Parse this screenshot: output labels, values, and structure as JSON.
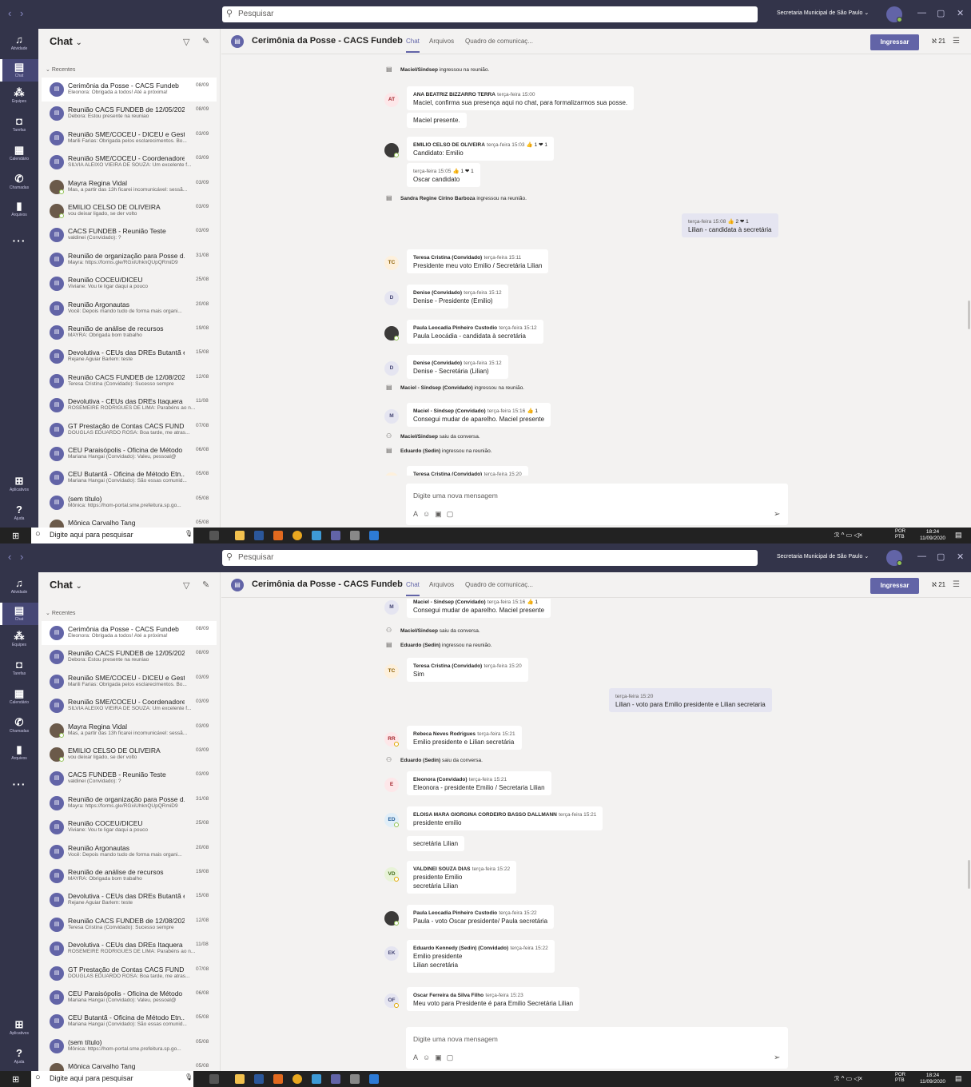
{
  "app": {
    "search_placeholder": "Pesquisar",
    "org": "Secretaria Municipal de São Paulo",
    "rail": [
      "Atividade",
      "Chat",
      "Equipes",
      "Tarefas",
      "Calendário",
      "Chamadas",
      "Arquivos"
    ],
    "rail_bottom": [
      "Aplicativos",
      "Ajuda"
    ]
  },
  "chatlist": {
    "title": "Chat",
    "section": "Recentes",
    "items": [
      {
        "title": "Cerimônia da Posse - CACS Fundeb",
        "preview": "Eleonora: Obrigada a todos! Até a próxima!",
        "date": "08/09"
      },
      {
        "title": "Reunião CACS FUNDEB de 12/05/2020",
        "preview": "Debora: Estou presente na reuniao",
        "date": "08/09"
      },
      {
        "title": "Reunião SME/COCEU - DICEU e Gesto...",
        "preview": "Marili Farias: Obrigada pelos esclarecimentos. Bo...",
        "date": "03/09"
      },
      {
        "title": "Reunião SME/COCEU - Coordenadore...",
        "preview": "SILVIA ALEIXO VIEIRA DE SOUZA: Um excelente f...",
        "date": "03/09"
      },
      {
        "title": "Mayra Regina Vidal",
        "preview": "Mas, a partir das 13h ficarei incomunicável: sessã...",
        "date": "03/09"
      },
      {
        "title": "EMILIO CELSO DE OLIVEIRA",
        "preview": "vou deixar ligado, se der volto",
        "date": "03/09"
      },
      {
        "title": "CACS FUNDEB - Reunião Teste",
        "preview": "valdinei (Convidado): ?",
        "date": "03/09"
      },
      {
        "title": "Reunião de organização para Posse d...",
        "preview": "Mayra: https://forms.gle/RGxiUhknQUpQRmiD9",
        "date": "31/08"
      },
      {
        "title": "Reunião COCEU/DICEU",
        "preview": "Viviane: Vou te ligar daqui a pouco",
        "date": "25/08"
      },
      {
        "title": "Reunião Argonautas",
        "preview": "Você: Depois mando tudo de forma mais organi...",
        "date": "20/08"
      },
      {
        "title": "Reunião de análise de recursos",
        "preview": "MAYRA: Obrigada bom trabalho",
        "date": "19/08"
      },
      {
        "title": "Devolutiva - CEUs das DREs Butantã e ...",
        "preview": "Rejane Aguiar Barlem: teste",
        "date": "15/08"
      },
      {
        "title": "Reunião CACS FUNDEB de 12/08/2020",
        "preview": "Teresa Cristina (Convidado): Sucesso sempre",
        "date": "12/08"
      },
      {
        "title": "Devolutiva - CEUs das DREs Itaquera e...",
        "preview": "ROSEMEIRE RODRIGUES DE LIMA: Parabéns ao n...",
        "date": "11/08"
      },
      {
        "title": "GT Prestação de Contas CACS FUNDE...",
        "preview": "DOUGLAS EDUARDO ROSA: Boa tarde, me atras...",
        "date": "07/08"
      },
      {
        "title": "CEU Paraisópolis - Oficina de Método ...",
        "preview": "Mariana Hangai (Convidado): Valeu, pessoal@",
        "date": "06/08"
      },
      {
        "title": "CEU Butantã - Oficina de Método Etn...",
        "preview": "Mariana Hangai (Convidado): São essas comunid...",
        "date": "05/08"
      },
      {
        "title": "(sem título)",
        "preview": "Mônica: https://hom-portal.sme.prefeitura.sp.go...",
        "date": "05/08"
      },
      {
        "title": "Mônica Carvalho Tang",
        "preview": "",
        "date": "05/08"
      }
    ]
  },
  "header": {
    "title": "Cerimônia da Posse - CACS Fundeb",
    "tabs": [
      "Chat",
      "Arquivos",
      "Quadro de comunicaç..."
    ],
    "join": "Ingressar",
    "participants": "21"
  },
  "compose_placeholder": "Digite uma nova mensagem",
  "screen1": [
    {
      "kind": "sys",
      "icon": "join",
      "name": "Maciel/Sindsep",
      "text": "ingressou na reunião."
    },
    {
      "kind": "msg",
      "initials": "AT",
      "name": "ANA BEATRIZ BIZZARRO TERRA",
      "time": "terça-feira 15:00",
      "reactions": "",
      "lines": [
        "Maciel, confirma sua presença aqui no chat, para formalizarmos sua posse."
      ]
    },
    {
      "kind": "cont",
      "lines": [
        "Maciel presente."
      ]
    },
    {
      "kind": "msg",
      "initials": "",
      "name": "EMILIO CELSO DE OLIVEIRA",
      "time": "terça-feira 15:03",
      "reactions": "👍 1  ❤ 1",
      "lines": [
        "Candidato: Emilio"
      ]
    },
    {
      "kind": "cont",
      "name": "",
      "time": "terça-feira 15:05",
      "reactions": "👍 1  ❤ 1",
      "lines": [
        "Oscar candidato"
      ]
    },
    {
      "kind": "sys",
      "icon": "join",
      "name": "Sandra Regine Cirino Barboza",
      "text": "ingressou na reunião."
    },
    {
      "kind": "self",
      "time": "terça-feira 15:08",
      "reactions": "👍 2  ❤ 1",
      "lines": [
        "Lilian - candidata à secretária"
      ]
    },
    {
      "kind": "msg",
      "initials": "TC",
      "name": "Teresa Cristina (Convidado)",
      "time": "terça-feira 15:11",
      "reactions": "",
      "lines": [
        "Presidente meu voto  Emilio / Secretária Lilian"
      ]
    },
    {
      "kind": "msg",
      "initials": "D",
      "name": "Denise (Convidado)",
      "time": "terça-feira 15:12",
      "reactions": "",
      "lines": [
        "Denise - Presidente (Emilio)"
      ]
    },
    {
      "kind": "msg",
      "initials": "",
      "name": "Paula Leocadia Pinheiro Custodio",
      "time": "terça-feira 15:12",
      "reactions": "",
      "lines": [
        "Paula Leocádia - candidata à secretária"
      ]
    },
    {
      "kind": "msg",
      "initials": "D",
      "name": "Denise (Convidado)",
      "time": "terça-feira 15:12",
      "reactions": "",
      "lines": [
        "Denise - Secretária  (Lilian)"
      ]
    },
    {
      "kind": "sys",
      "icon": "join",
      "name": "Maciel - Sindsep (Convidado)",
      "text": "ingressou na reunião."
    },
    {
      "kind": "msg",
      "initials": "M",
      "name": "Maciel - Sindsep (Convidado)",
      "time": "terça-feira 15:16",
      "reactions": "👍 1",
      "lines": [
        "Consegui mudar de aparelho. Maciel presente"
      ]
    },
    {
      "kind": "sys",
      "icon": "leave",
      "name": "Maciel/Sindsep",
      "text": "saiu da conversa."
    },
    {
      "kind": "sys",
      "icon": "join",
      "name": "Eduardo (Sedin)",
      "text": "ingressou na reunião."
    },
    {
      "kind": "msg",
      "initials": "TC",
      "name": "Teresa Cristina (Convidado)",
      "time": "terça-feira 15:20",
      "reactions": "",
      "lines": [
        ""
      ]
    }
  ],
  "screen2": [
    {
      "kind": "msg",
      "initials": "M",
      "name": "Maciel - Sindsep (Convidado)",
      "time": "terça-feira 15:16",
      "reactions": "👍 1",
      "lines": [
        "Consegui mudar de aparelho. Maciel presente"
      ]
    },
    {
      "kind": "sys",
      "icon": "leave",
      "name": "Maciel/Sindsep",
      "text": "saiu da conversa."
    },
    {
      "kind": "sys",
      "icon": "join",
      "name": "Eduardo (Sedin)",
      "text": "ingressou na reunião."
    },
    {
      "kind": "msg",
      "initials": "TC",
      "name": "Teresa Cristina (Convidado)",
      "time": "terça-feira 15:20",
      "reactions": "",
      "lines": [
        "Sim"
      ]
    },
    {
      "kind": "self",
      "time": "terça-feira 15:20",
      "reactions": "",
      "lines": [
        "Lilian - voto para Emilio presidente e Lilian secretaria"
      ]
    },
    {
      "kind": "msg",
      "initials": "RR",
      "name": "Rebeca Neves Rodrigues",
      "time": "terça-feira 15:21",
      "reactions": "",
      "lines": [
        "Emilio presidente e Lilian secretária"
      ]
    },
    {
      "kind": "sys",
      "icon": "leave",
      "name": "Eduardo (Sedin)",
      "text": "saiu da conversa."
    },
    {
      "kind": "msg",
      "initials": "E",
      "name": "Eleonora (Convidado)",
      "time": "terça-feira 15:21",
      "reactions": "",
      "lines": [
        "Eleonora - presidente Emilio / Secretaria Lilian"
      ]
    },
    {
      "kind": "msg",
      "initials": "ED",
      "name": "ELOISA MARA GIORGINA CORDEIRO BASSO DALLMANN",
      "time": "terça-feira 15:21",
      "reactions": "",
      "lines": [
        "presidente emilio"
      ]
    },
    {
      "kind": "cont",
      "lines": [
        "secretária Lilian"
      ]
    },
    {
      "kind": "msg",
      "initials": "VD",
      "name": "VALDINEI SOUZA DIAS",
      "time": "terça-feira 15:22",
      "reactions": "",
      "lines": [
        "presidente Emilio",
        "secretária Lilian"
      ]
    },
    {
      "kind": "msg",
      "initials": "",
      "name": "Paula Leocadia Pinheiro Custodio",
      "time": "terça-feira 15:22",
      "reactions": "",
      "lines": [
        "Paula - voto Oscar presidente/ Paula secretária"
      ]
    },
    {
      "kind": "msg",
      "initials": "EK",
      "name": "Eduardo Kennedy (Sedin) (Convidado)",
      "time": "terça-feira 15:22",
      "reactions": "",
      "lines": [
        "Emilio presidente",
        "Lilian secretária"
      ]
    },
    {
      "kind": "msg",
      "initials": "OF",
      "name": "Oscar Ferreira da Silva Filho",
      "time": "terça-feira 15:23",
      "reactions": "",
      "lines": [
        "Meu voto para Presidente é para Emilio Secretária Lilian"
      ]
    }
  ],
  "taskbar": {
    "search": "Digite aqui para pesquisar",
    "lang1": "POR",
    "lang2": "PTB",
    "time": "18:24",
    "date": "11/09/2020"
  },
  "colors": {
    "rail": "#33344a",
    "accent": "#6264a7",
    "self_bubble": "#e5e5f1"
  }
}
